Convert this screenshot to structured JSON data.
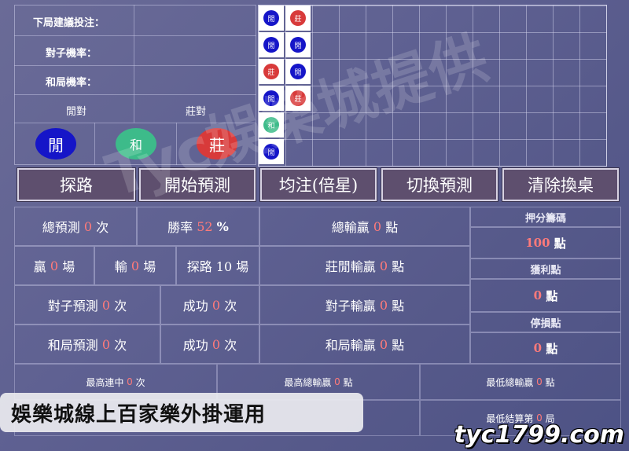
{
  "top_panel": {
    "next_bet_label": "下局建議投注：",
    "pair_rate_label": "對子機率：",
    "tie_rate_label": "和局機率：",
    "player_pair_label": "閒對",
    "banker_pair_label": "莊對",
    "player_circle": "閒",
    "tie_circle": "和",
    "banker_circle": "莊"
  },
  "bead_road": {
    "col1": [
      "閒",
      "閒",
      "莊",
      "閒",
      "和",
      "閒"
    ],
    "col2": [
      "莊",
      "閒",
      "閒",
      "莊"
    ]
  },
  "buttons": {
    "explore": "探路",
    "start_predict": "開始預測",
    "flat_bet": "均注(倍星)",
    "switch_predict": "切換預測",
    "clear_table": "清除換桌"
  },
  "stats": {
    "total_predict_pre": "總預測",
    "total_predict_val": "0",
    "total_predict_post": "次",
    "win_rate_pre": "勝率",
    "win_rate_val": "52",
    "win_rate_post": "%",
    "total_win_pre": "總輸贏",
    "total_win_val": "0",
    "total_win_post": "點",
    "win_pre": "贏",
    "win_val": "0",
    "win_post": "場",
    "lose_pre": "輸",
    "lose_val": "0",
    "lose_post": "場",
    "explore_rounds": "探路 10 場",
    "bp_win_pre": "莊閒輸贏",
    "bp_win_val": "0",
    "bp_win_post": "點",
    "pair_predict_pre": "對子預測",
    "pair_predict_val": "0",
    "pair_predict_post": "次",
    "success1_pre": "成功",
    "success1_val": "0",
    "success1_post": "次",
    "pair_win_pre": "對子輸贏",
    "pair_win_val": "0",
    "pair_win_post": "點",
    "tie_predict_pre": "和局預測",
    "tie_predict_val": "0",
    "tie_predict_post": "次",
    "success2_pre": "成功",
    "success2_val": "0",
    "success2_post": "次",
    "tie_win_pre": "和局輸贏",
    "tie_win_val": "0",
    "tie_win_post": "點"
  },
  "side": {
    "stake_label": "押分籌碼",
    "stake_val": "100",
    "stake_unit": "點",
    "profit_label": "獲利點",
    "profit_val": "0",
    "profit_unit": "點",
    "stop_loss_label": "停損點",
    "stop_loss_val": "0",
    "stop_loss_unit": "點"
  },
  "bottom": {
    "max_streak_pre": "最高連中",
    "max_streak_val": "0",
    "max_streak_post": "次",
    "max_total_pre": "最高總輸贏",
    "max_total_val": "0",
    "max_total_post": "點",
    "min_total_pre": "最低總輸贏",
    "min_total_val": "0",
    "min_total_post": "點",
    "min_settle_pre": "最低結算第",
    "min_settle_val": "0",
    "min_settle_post": "局"
  },
  "overlay": {
    "watermark": "Tyc娛樂城提供",
    "banner": "娛樂城線上百家樂外掛運用",
    "site": "tyc1799.com"
  },
  "colors": {
    "player": "#1515c8",
    "banker": "#d83a3a",
    "tie": "#3dbb8a",
    "button_bg": "#5e4f6e"
  }
}
